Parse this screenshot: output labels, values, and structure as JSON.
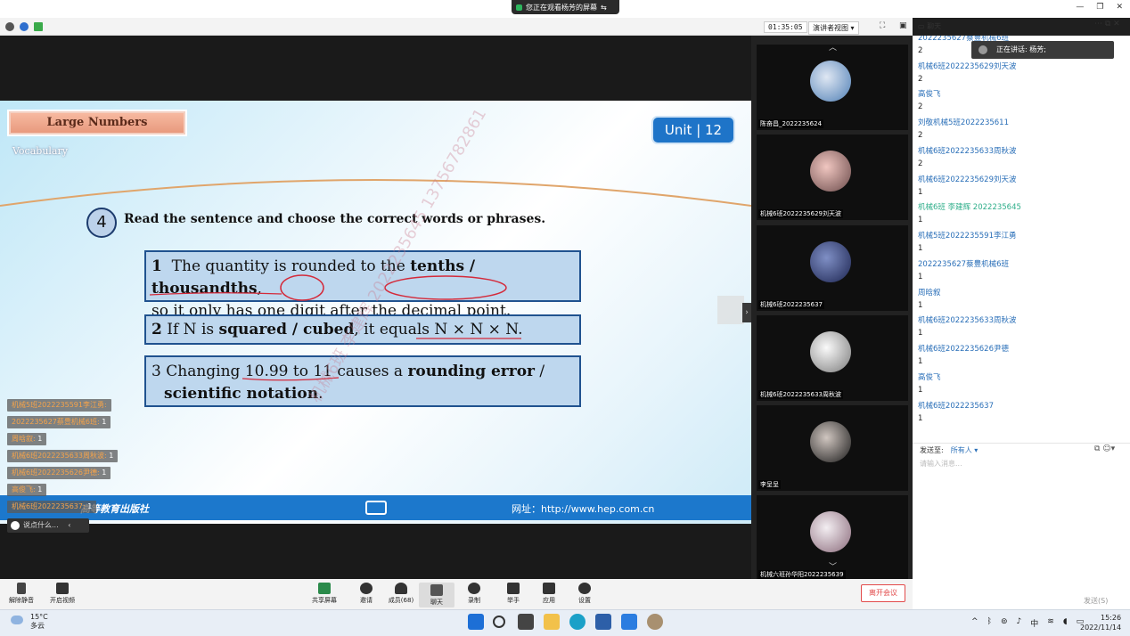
{
  "banner": {
    "text": "您正在观看杨芳的屏幕"
  },
  "toolbar": {
    "timer": "01:35:05",
    "view_mode": "演讲者视图",
    "chat_label": "聊天"
  },
  "slide": {
    "title": "Large Numbers",
    "section": "Vocabulary",
    "unit": "Unit  |  12",
    "question_number": "4",
    "instruction": "Read the sentence  and choose the correct words or phrases.",
    "items": [
      {
        "num": "1",
        "pre": "The quantity is rounded to the ",
        "bold": "tenths / thousandths",
        "post": ",",
        "line2": "so it only has one digit after the decimal point."
      },
      {
        "num": "2",
        "pre": "If N is ",
        "bold": "squared / cubed",
        "post": ", it equals N × N × N."
      },
      {
        "num": "3",
        "pre": "Changing 10.99 to 11 causes a ",
        "bold": "rounding error",
        "post": " /",
        "line2bold": "scientific notation",
        "line2post": "."
      }
    ],
    "footer_publisher": "高等教育出版社",
    "footer_url": "网址：http://www.hep.com.cn",
    "watermark": "机械6班 李建辉 2022235645 13756782861"
  },
  "danmu": [
    {
      "name": "机械5班2022235591李江勇:",
      "count": ""
    },
    {
      "name": "2022235627蔡豊机械6班:",
      "count": "1"
    },
    {
      "name": "周晗叙:",
      "count": "1"
    },
    {
      "name": "机械6班2022235633周秋波:",
      "count": "1"
    },
    {
      "name": "机械6班2022235626尹德:",
      "count": "1"
    },
    {
      "name": "高俊飞:",
      "count": "1"
    },
    {
      "name": "机械6班2022235637:",
      "count": "1"
    }
  ],
  "danmu_input": "说点什么...",
  "gallery": [
    {
      "name": "陈奋昌_2022235624"
    },
    {
      "name": "机械6班2022235629刘天波"
    },
    {
      "name": "机械6班2022235637"
    },
    {
      "name": "机械6班2022235633周秋波"
    },
    {
      "name": "李呈呈"
    },
    {
      "name": "机械六班孙华阳2022235639"
    }
  ],
  "speaking": "正在讲话: 杨芳;",
  "chat": [
    {
      "t": "2022235627蔡豊机械6班",
      "c": "n"
    },
    {
      "t": "2",
      "c": "v"
    },
    {
      "t": "机械6班2022235629刘天波",
      "c": "n"
    },
    {
      "t": "2",
      "c": "v"
    },
    {
      "t": "高俊飞",
      "c": "n"
    },
    {
      "t": "2",
      "c": "v"
    },
    {
      "t": "刘敬机械5班2022235611",
      "c": "n"
    },
    {
      "t": "2",
      "c": "v"
    },
    {
      "t": "机械6班2022235633周秋波",
      "c": "n"
    },
    {
      "t": "2",
      "c": "v"
    },
    {
      "t": "机械6班2022235629刘天波",
      "c": "n"
    },
    {
      "t": "1",
      "c": "v"
    },
    {
      "t": "机械6班 李建辉 2022235645",
      "c": "g"
    },
    {
      "t": "1",
      "c": "v"
    },
    {
      "t": "机械5班2022235591李江勇",
      "c": "n"
    },
    {
      "t": "1",
      "c": "v"
    },
    {
      "t": "2022235627蔡豊机械6班",
      "c": "n"
    },
    {
      "t": "1",
      "c": "v"
    },
    {
      "t": "周晗叙",
      "c": "n"
    },
    {
      "t": "1",
      "c": "v"
    },
    {
      "t": "机械6班2022235633周秋波",
      "c": "n"
    },
    {
      "t": "1",
      "c": "v"
    },
    {
      "t": "机械6班2022235626尹德",
      "c": "n"
    },
    {
      "t": "1",
      "c": "v"
    },
    {
      "t": "高俊飞",
      "c": "n"
    },
    {
      "t": "1",
      "c": "v"
    },
    {
      "t": "机械6班2022235637",
      "c": "n"
    },
    {
      "t": "1",
      "c": "v"
    }
  ],
  "chat_footer": {
    "send_to_label": "发送至:",
    "send_to_value": "所有人 ▾",
    "input_placeholder": "请输入消息...",
    "send_button": "发送(S)"
  },
  "bottom": {
    "mute": "解除静音",
    "video": "开启视频",
    "share": "共享屏幕",
    "invite": "邀请",
    "members": "成员(68)",
    "chat": "聊天",
    "record": "录制",
    "raise_hand": "举手",
    "apps": "应用",
    "settings": "设置",
    "leave": "离开会议"
  },
  "taskbar": {
    "temp": "15°C",
    "weather": "多云",
    "time": "15:26",
    "date": "2022/11/14",
    "ime": "中"
  }
}
